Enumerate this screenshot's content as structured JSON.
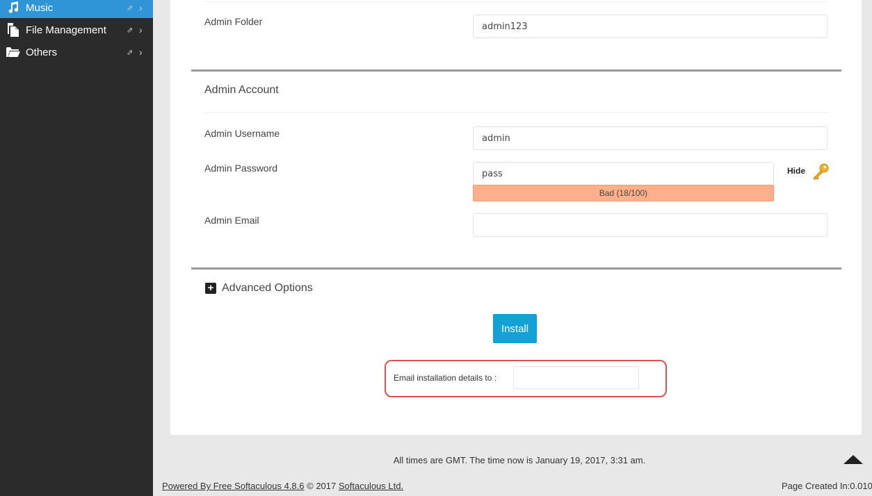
{
  "sidebar": {
    "items": [
      {
        "label": "Music",
        "icon": "music-note-icon",
        "active": true
      },
      {
        "label": "File Management",
        "icon": "file-icon",
        "active": false
      },
      {
        "label": "Others",
        "icon": "folder-open-icon",
        "active": false
      }
    ]
  },
  "form": {
    "admin_folder": {
      "label": "Admin Folder",
      "value": "admin123"
    },
    "admin_account": {
      "title": "Admin Account",
      "username": {
        "label": "Admin Username",
        "value": "admin"
      },
      "password": {
        "label": "Admin Password",
        "value": "pass",
        "strength": "Bad (18/100)",
        "strength_value": 18,
        "toggle_label": "Hide"
      },
      "email": {
        "label": "Admin Email",
        "value": ""
      }
    },
    "advanced_options": {
      "label": "Advanced Options",
      "icon": "plus-square-icon"
    },
    "install_button": "Install",
    "email_details": {
      "label": "Email installation details to :",
      "value": ""
    }
  },
  "footer": {
    "time_text": "All times are GMT. The time now is January 19, 2017, 3:31 am.",
    "powered_link": "Powered By Free Softaculous 4.8.6",
    "copyright": " © 2017 ",
    "company_link": "Softaculous Ltd.",
    "page_created": "Page Created In:0.010"
  },
  "colors": {
    "sidebar_bg": "#2b2b2b",
    "active_item": "#2f95d6",
    "install_button": "#14a1d6",
    "strength_bad": "#ffb08a",
    "highlight_border": "#d9534f"
  }
}
